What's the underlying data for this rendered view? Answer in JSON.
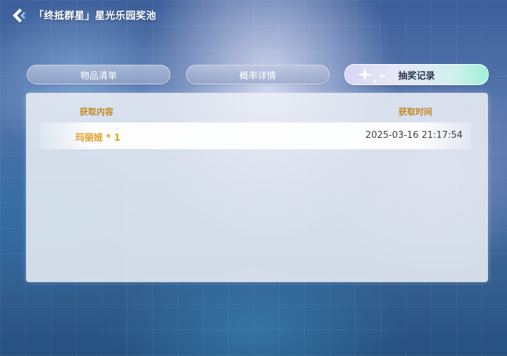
{
  "header": {
    "title": "「终抵群星」星光乐园奖池"
  },
  "tabs": [
    {
      "label": "物品清单",
      "active": false
    },
    {
      "label": "概率详情",
      "active": false
    },
    {
      "label": "抽奖记录",
      "active": true
    }
  ],
  "table": {
    "columns": [
      "获取内容",
      "获取时间"
    ],
    "rows": [
      {
        "item": "玛丽娅 * 1",
        "time": "2025-03-16 21:17:54"
      }
    ]
  },
  "colors": {
    "header_text": "#c08a2a",
    "item_text": "#e0a020",
    "active_tab_gradient_end": "#9ff0d8"
  }
}
